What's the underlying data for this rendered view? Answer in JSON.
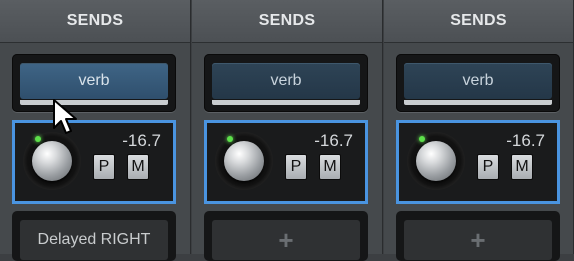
{
  "strips": [
    {
      "header": "SENDS",
      "send_label": "verb",
      "level": "-16.7",
      "pre_label": "P",
      "mute_label": "M",
      "next_slot": "Delayed RIGHT"
    },
    {
      "header": "SENDS",
      "send_label": "verb",
      "level": "-16.7",
      "pre_label": "P",
      "mute_label": "M",
      "next_slot": "+"
    },
    {
      "header": "SENDS",
      "send_label": "verb",
      "level": "-16.7",
      "pre_label": "P",
      "mute_label": "M",
      "next_slot": "+"
    }
  ],
  "colors": {
    "selection_outline": "#4a94e0",
    "send_button": "#2e4456",
    "send_button_hover": "#3f6586",
    "led": "#5de04a"
  },
  "icons": {
    "cursor": "mouse-pointer-icon",
    "add": "plus-icon"
  }
}
